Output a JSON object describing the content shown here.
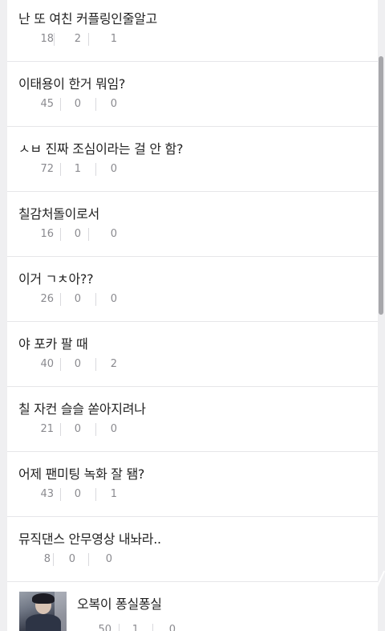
{
  "posts": [
    {
      "title": "난 또 여친 커플링인줄알고",
      "views": "18",
      "likes": "2",
      "comments": "1"
    },
    {
      "title": "이태용이 한거 뭐임?",
      "views": "45",
      "likes": "0",
      "comments": "0"
    },
    {
      "title": "ㅅㅂ 진짜 조심이라는 걸 안 함?",
      "views": "72",
      "likes": "1",
      "comments": "0"
    },
    {
      "title": "칠감처돌이로서",
      "views": "16",
      "likes": "0",
      "comments": "0"
    },
    {
      "title": "이거 ㄱㅊ아??",
      "views": "26",
      "likes": "0",
      "comments": "0"
    },
    {
      "title": "야 포카 팔 때",
      "views": "40",
      "likes": "0",
      "comments": "2"
    },
    {
      "title": "칠 자컨 슬슬 쏟아지려나",
      "views": "21",
      "likes": "0",
      "comments": "0"
    },
    {
      "title": "어제 팬미팅 녹화 잘 됌?",
      "views": "43",
      "likes": "0",
      "comments": "1"
    },
    {
      "title": "뮤직댄스 안무영상 내놔라..",
      "views": "8",
      "likes": "0",
      "comments": "0"
    },
    {
      "title": "오복이 퐁실퐁실",
      "views": "50",
      "likes": "1",
      "comments": "0",
      "has_thumbnail": true
    }
  ]
}
